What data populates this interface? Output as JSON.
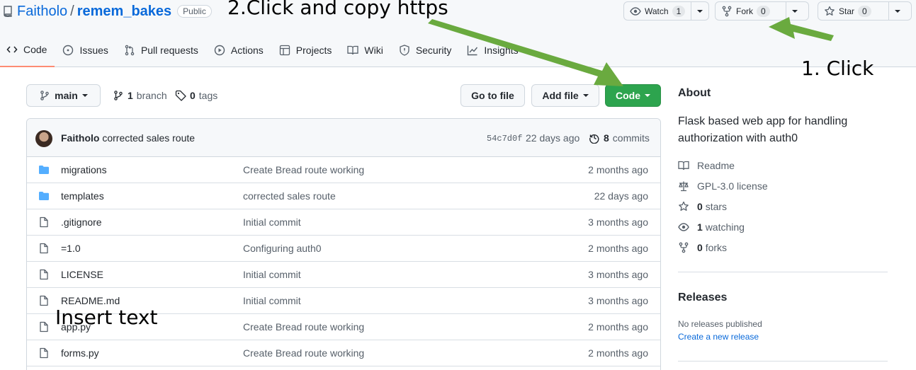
{
  "repo": {
    "owner": "Faitholo",
    "separator": "/",
    "name": "remem_bakes",
    "visibility": "Public"
  },
  "header_actions": {
    "watch": {
      "label": "Watch",
      "count": "1"
    },
    "fork": {
      "label": "Fork",
      "count": "0"
    },
    "star": {
      "label": "Star",
      "count": "0"
    }
  },
  "tabs": [
    {
      "label": "Code",
      "icon": "code-icon"
    },
    {
      "label": "Issues",
      "icon": "issue-icon"
    },
    {
      "label": "Pull requests",
      "icon": "pull-request-icon"
    },
    {
      "label": "Actions",
      "icon": "play-icon"
    },
    {
      "label": "Projects",
      "icon": "table-icon"
    },
    {
      "label": "Wiki",
      "icon": "book-icon"
    },
    {
      "label": "Security",
      "icon": "shield-icon"
    },
    {
      "label": "Insights",
      "icon": "graph-icon"
    }
  ],
  "branch_bar": {
    "branch": "main",
    "branch_count": "1",
    "branch_label": "branch",
    "tag_count": "0",
    "tag_label": "tags",
    "go_to_file": "Go to file",
    "add_file": "Add file",
    "code": "Code"
  },
  "latest_commit": {
    "author": "Faitholo",
    "message": "corrected sales route",
    "hash": "54c7d0f",
    "when": "22 days ago",
    "commit_count": "8",
    "commit_label": "commits"
  },
  "files": [
    {
      "type": "dir",
      "name": "migrations",
      "message": "Create Bread route working",
      "age": "2 months ago"
    },
    {
      "type": "dir",
      "name": "templates",
      "message": "corrected sales route",
      "age": "22 days ago"
    },
    {
      "type": "file",
      "name": ".gitignore",
      "message": "Initial commit",
      "age": "3 months ago"
    },
    {
      "type": "file",
      "name": "=1.0",
      "message": "Configuring auth0",
      "age": "2 months ago"
    },
    {
      "type": "file",
      "name": "LICENSE",
      "message": "Initial commit",
      "age": "3 months ago"
    },
    {
      "type": "file",
      "name": "README.md",
      "message": "Initial commit",
      "age": "3 months ago"
    },
    {
      "type": "file",
      "name": "app.py",
      "message": "Create Bread route working",
      "age": "2 months ago"
    },
    {
      "type": "file",
      "name": "forms.py",
      "message": "Create Bread route working",
      "age": "2 months ago"
    }
  ],
  "about": {
    "title": "About",
    "description": "Flask based web app for handling authorization with auth0",
    "readme": "Readme",
    "license": "GPL-3.0 license",
    "stars_count": "0",
    "stars_label": "stars",
    "watching_count": "1",
    "watching_label": "watching",
    "forks_count": "0",
    "forks_label": "forks"
  },
  "releases": {
    "title": "Releases",
    "none": "No releases published",
    "create_link": "Create a new release"
  },
  "annotations": {
    "step1": "1. Click",
    "step2": "2.Click and copy https",
    "insert": "Insert text",
    "arrow_color": "#6aaa3f"
  },
  "colors": {
    "link": "#0969da",
    "primary_button": "#2da44e",
    "folder": "#54aeff",
    "active_tab_underline": "#fd8c73"
  }
}
